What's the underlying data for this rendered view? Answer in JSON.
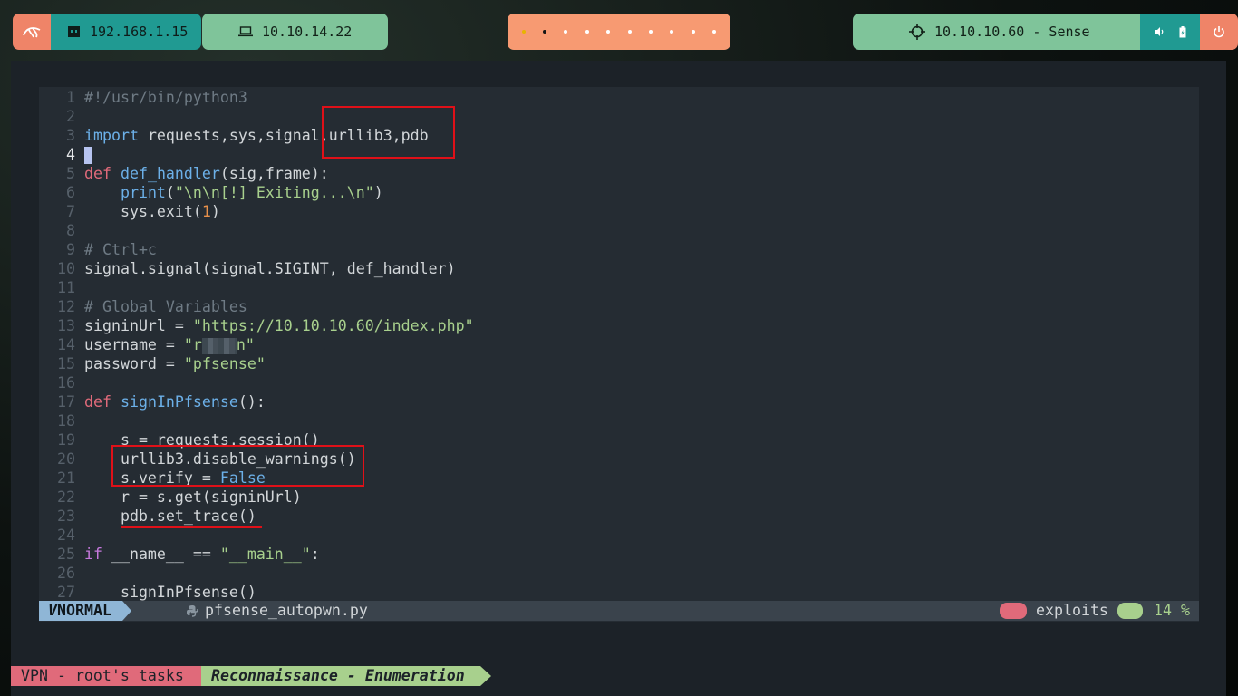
{
  "topbar": {
    "host_ip": "192.168.1.15",
    "vpn_ip": "10.10.14.22",
    "target": "10.10.10.60 - Sense",
    "workspaces": 10,
    "active_workspace": 2
  },
  "editor": {
    "lines": [
      {
        "n": "1",
        "text": "#!/usr/bin/python3"
      },
      {
        "n": "2",
        "text": ""
      },
      {
        "n": "3",
        "text": "import requests,sys,signal,urllib3,pdb"
      },
      {
        "n": "4",
        "text": ""
      },
      {
        "n": "5",
        "text": "def def_handler(sig,frame):"
      },
      {
        "n": "6",
        "text": "    print(\"\\n\\n[!] Exiting...\\n\")"
      },
      {
        "n": "7",
        "text": "    sys.exit(1)"
      },
      {
        "n": "8",
        "text": ""
      },
      {
        "n": "9",
        "text": "# Ctrl+c"
      },
      {
        "n": "10",
        "text": "signal.signal(signal.SIGINT, def_handler)"
      },
      {
        "n": "11",
        "text": ""
      },
      {
        "n": "12",
        "text": "# Global Variables"
      },
      {
        "n": "13",
        "text": "signinUrl = \"https://10.10.10.60/index.php\""
      },
      {
        "n": "14",
        "text": "username = \"r    n\""
      },
      {
        "n": "15",
        "text": "password = \"pfsense\""
      },
      {
        "n": "16",
        "text": ""
      },
      {
        "n": "17",
        "text": "def signInPfsense():"
      },
      {
        "n": "18",
        "text": ""
      },
      {
        "n": "19",
        "text": "    s = requests.session()"
      },
      {
        "n": "20",
        "text": "    urllib3.disable_warnings()"
      },
      {
        "n": "21",
        "text": "    s.verify = False"
      },
      {
        "n": "22",
        "text": "    r = s.get(signinUrl)"
      },
      {
        "n": "23",
        "text": "    pdb.set_trace()"
      },
      {
        "n": "24",
        "text": ""
      },
      {
        "n": "25",
        "text": "if __name__ == \"__main__\":"
      },
      {
        "n": "26",
        "text": ""
      },
      {
        "n": "27",
        "text": "    signInPfsense()"
      }
    ],
    "current_line": "4"
  },
  "statusline": {
    "mode": "NORMAL",
    "filename": "pfsense_autopwn.py",
    "directory": "exploits",
    "percent": "14 %"
  },
  "tmux": {
    "session": "VPN - root's tasks",
    "window": "Reconnaissance - Enumeration"
  },
  "colors": {
    "accent_red": "#e01018",
    "keyword": "#e06a7a",
    "function": "#6cb0e8",
    "string": "#a8d08d",
    "number": "#e8914b"
  }
}
